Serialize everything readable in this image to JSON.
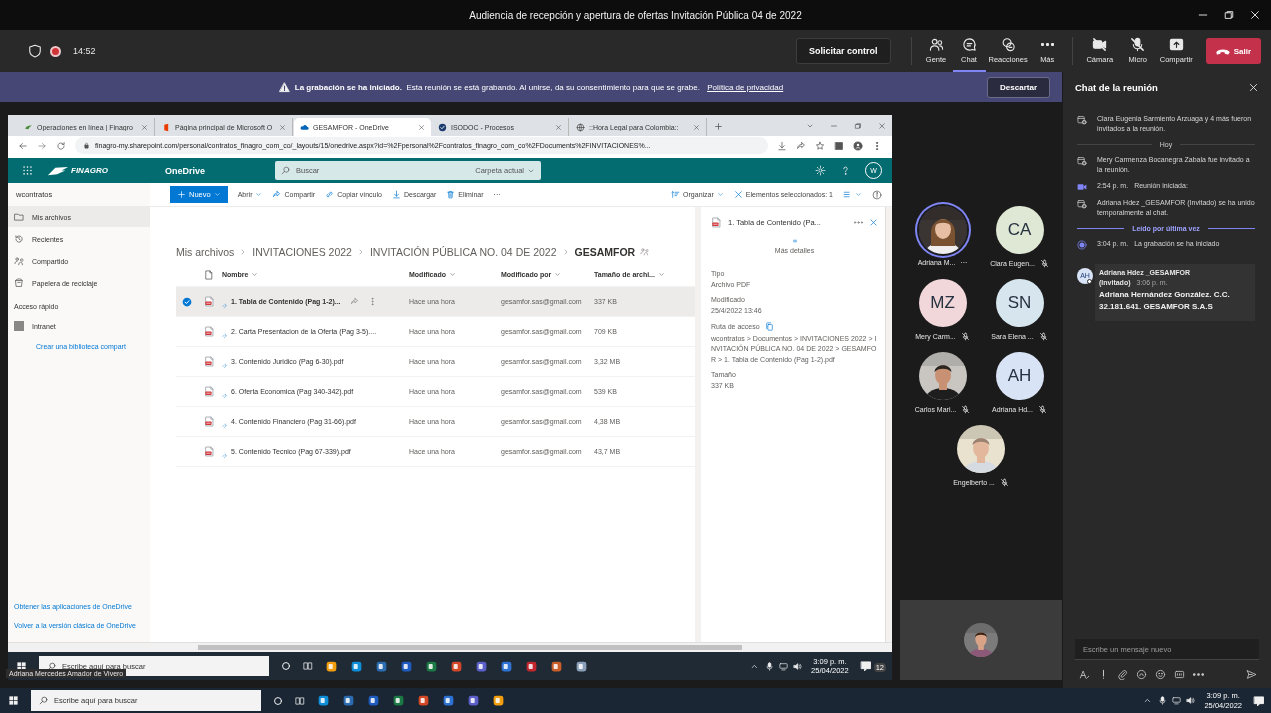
{
  "window": {
    "title": "Audiencia de recepción y apertura de ofertas Invitación Pública 04 de 2022"
  },
  "meeting_bar": {
    "recording": true,
    "timer": "14:52",
    "request_button": "Solicitar control",
    "actions": [
      {
        "label": "Gente",
        "kind": "people",
        "selected": false
      },
      {
        "label": "Chat",
        "kind": "chat",
        "selected": true
      },
      {
        "label": "Reacciones",
        "kind": "reactions",
        "selected": false
      },
      {
        "label": "Más",
        "kind": "more",
        "selected": false
      }
    ],
    "media": [
      {
        "label": "Cámara",
        "kind": "camera",
        "off": true
      },
      {
        "label": "Micro",
        "kind": "mic",
        "off": true
      },
      {
        "label": "Compartir",
        "kind": "share",
        "off": false
      }
    ],
    "leave_button": "Salir"
  },
  "banner": {
    "text": "**La grabación se ha iniciado.**  Esta reunión se está grabando. Al unirse, da su consentimiento para que se grabe.",
    "link": "Política de privacidad",
    "dismiss_button": "Descartar"
  },
  "shared_screen": {
    "tabs": [
      {
        "label": "Operaciones en línea | Finagro",
        "kind": "finagro",
        "selected": false
      },
      {
        "label": "Página principal de Microsoft O",
        "kind": "office",
        "selected": false
      },
      {
        "label": "GESAMFOR - OneDrive",
        "kind": "onedrive",
        "selected": true
      },
      {
        "label": "ISODOC - Procesos",
        "kind": "check",
        "selected": false
      },
      {
        "label": "::Hora Legal para Colombia::",
        "kind": "globe",
        "selected": false
      }
    ],
    "url": "finagro-my.sharepoint.com/personal/contratos_finagro_com_co/_layouts/15/onedrive.aspx?id=%2Fpersonal%2Fcontratos_finagro_com_co%2FDocuments%2FINVITACIONES%...",
    "suite": {
      "logo": "FINAGRO",
      "app": "OneDrive",
      "search_placeholder": "Buscar",
      "scope": "Carpeta actual",
      "avatar": "W"
    },
    "site": "wcontratos",
    "commands": [
      {
        "label": "Nuevo",
        "kind": "new"
      },
      {
        "label": "Abrir",
        "kind": "open"
      },
      {
        "label": "Compartir",
        "kind": "share"
      },
      {
        "label": "Copiar vínculo",
        "kind": "link"
      },
      {
        "label": "Descargar",
        "kind": "download"
      },
      {
        "label": "Eliminar",
        "kind": "delete"
      },
      {
        "label": "···",
        "kind": "more"
      }
    ],
    "organize": "Organizar",
    "selection": "Elementos seleccionados: 1",
    "nav": [
      {
        "label": "Mis archivos",
        "kind": "folder",
        "selected": true
      },
      {
        "label": "Recientes",
        "kind": "recent",
        "selected": false
      },
      {
        "label": "Compartido",
        "kind": "shared",
        "selected": false
      },
      {
        "label": "Papelera de reciclaje",
        "kind": "trash",
        "selected": false
      }
    ],
    "quick_access": {
      "title": "Acceso rápido",
      "items": [
        {
          "label": "Intranet"
        }
      ],
      "create_link": "Crear una biblioteca compart"
    },
    "footer_links": [
      "Obtener las aplicaciones de OneDrive",
      "Volver a la versión clásica de OneDrive"
    ],
    "breadcrumb": [
      "Mis archivos",
      "INVITACIONES 2022",
      "INVITACIÓN PÚBLICA NO. 04 DE 2022",
      "GESAMFOR"
    ],
    "columns": [
      "Nombre",
      "Modificado",
      "Modificado por",
      "Tamaño de archi..."
    ],
    "rows": [
      {
        "name": "1. Tabla de Contenido (Pag 1-2)...",
        "modified": "Hace una hora",
        "modified_by": "gesamfor.sas@gmail.com",
        "size": "337 KB",
        "selected": true
      },
      {
        "name": "2. Carta Presentacion de la Oferta (Pag 3-5)....",
        "modified": "Hace una hora",
        "modified_by": "gesamfor.sas@gmail.com",
        "size": "709 KB",
        "selected": false
      },
      {
        "name": "3. Contenido Juridico (Pag 6-30).pdf",
        "modified": "Hace una hora",
        "modified_by": "gesamfor.sas@gmail.com",
        "size": "3,32 MB",
        "selected": false
      },
      {
        "name": "6. Oferta Economica (Pag 340-342).pdf",
        "modified": "Hace una hora",
        "modified_by": "gesamfor.sas@gmail.com",
        "size": "539 KB",
        "selected": false
      },
      {
        "name": "4. Contenido Financiero (Pag 31-66).pdf",
        "modified": "Hace una hora",
        "modified_by": "gesamfor.sas@gmail.com",
        "size": "4,38 MB",
        "selected": false
      },
      {
        "name": "5. Contenido Tecnico (Pag 67-339).pdf",
        "modified": "Hace una hora",
        "modified_by": "gesamfor.sas@gmail.com",
        "size": "43,7 MB",
        "selected": false
      }
    ],
    "details": {
      "title": "1. Tabla de Contenido (Pa...",
      "more": "Más detalles",
      "fields": [
        {
          "label": "Tipo",
          "value": "Archivo PDF"
        },
        {
          "label": "Modificado",
          "value": "25/4/2022 13:46"
        },
        {
          "label": "Ruta de acceso",
          "value": "wcontratos > Documentos > INVITACIONES 2022 > INVITACIÓN PÚBLICA NO. 04 DE 2022 > GESAMFOR > 1. Tabla de Contenido (Pag 1-2).pdf",
          "copy": true
        },
        {
          "label": "Tamaño",
          "value": "337 KB"
        }
      ]
    },
    "taskbar": {
      "search_placeholder": "Escribe aquí para buscar",
      "time": "3:09 p. m.",
      "date": "25/04/2022",
      "notifications": "12"
    },
    "presenter": "Adriana Mercedes Amador de Vivero"
  },
  "participants": [
    {
      "name": "Adriana M...",
      "speaking": true,
      "muted": false,
      "menu": "···"
    },
    {
      "name": "Clara Eugen...",
      "kind": "initials",
      "initials": "CA",
      "color": "#dfe8d4",
      "speaking": false,
      "muted": true
    },
    {
      "name": "Mery Carm...",
      "kind": "initials",
      "initials": "MZ",
      "color": "#f2d7da",
      "speaking": false,
      "muted": true
    },
    {
      "name": "Sara Elena ...",
      "kind": "initials",
      "initials": "SN",
      "color": "#d7e6ee",
      "speaking": false,
      "muted": true
    },
    {
      "name": "Carlos Mari...",
      "speaking": false,
      "muted": true
    },
    {
      "name": "Adriana Hd...",
      "kind": "initials",
      "initials": "AH",
      "color": "#d8e3f5",
      "speaking": false,
      "muted": true
    },
    {
      "name": "Engelberto ...",
      "speaking": false,
      "muted": true
    }
  ],
  "chat": {
    "title": "Chat de la reunión",
    "events": [
      {
        "kind": "invite",
        "text": "Clara Eugenia Sarmiento Arzuaga y 4 más fueron invitados a la reunión."
      },
      {
        "kind": "divider",
        "text": "Hoy"
      },
      {
        "kind": "invite",
        "text": "Mery Carmenza Bocanegra Zabala fue invitado a la reunión."
      },
      {
        "kind": "meeting",
        "time": "2:54 p. m.",
        "text": "Reunión iniciada:"
      },
      {
        "kind": "invite",
        "text": "Adriana Hdez _GESAMFOR (Invitado) se ha unido temporalmente al chat."
      },
      {
        "kind": "last-read",
        "text": "Leído por última vez"
      },
      {
        "kind": "recording",
        "time": "3:04 p. m.",
        "text": "La grabación se ha iniciado"
      },
      {
        "kind": "message",
        "initials": "AH",
        "author": "Adriana Hdez _GESAMFOR",
        "role": "(Invitado)",
        "time": "3:06 p. m.",
        "text": "Adriana Hernández González. C.C. 32.181.641. GESAMFOR S.A.S"
      }
    ],
    "composer_placeholder": "Escribe un mensaje nuevo"
  },
  "taskbar": {
    "search_placeholder": "Escribe aquí para buscar",
    "time": "3:09 p. m.",
    "date": "25/04/2022"
  }
}
